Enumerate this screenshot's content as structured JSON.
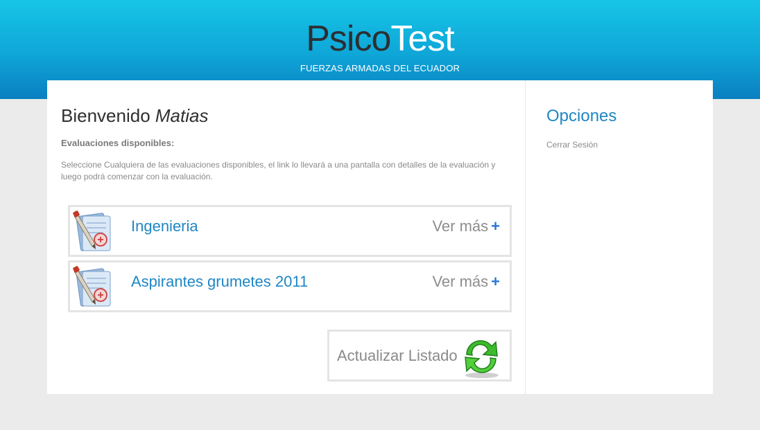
{
  "header": {
    "logo_part1": "Psico",
    "logo_part2": "Test",
    "subtitle": "FUERZAS ARMADAS DEL ECUADOR"
  },
  "main": {
    "welcome_prefix": "Bienvenido",
    "user_name": "Matias",
    "section_title": "Evaluaciones disponibles:",
    "description": "Seleccione Cualquiera de las evaluaciones disponibles, el link lo llevará a una pantalla con detalles de la evaluación y luego podrá comenzar con la evaluación.",
    "evaluations": [
      {
        "name": "Ingenieria",
        "action_label": "Ver más",
        "action_symbol": "+",
        "icon": "document-pen-icon"
      },
      {
        "name": "Aspirantes grumetes 2011",
        "action_label": "Ver más",
        "action_symbol": "+",
        "icon": "document-pen-icon"
      }
    ],
    "refresh_button": {
      "label": "Actualizar Listado",
      "icon": "refresh-arrows-icon"
    }
  },
  "sidebar": {
    "title": "Opciones",
    "links": [
      {
        "label": "Cerrar Sesión"
      }
    ]
  },
  "colors": {
    "header_top": "#16c5e6",
    "header_bottom": "#0a7fc0",
    "accent_blue": "#1f86c4",
    "plus_blue": "#2a75d4",
    "page_bg": "#ebebeb"
  }
}
